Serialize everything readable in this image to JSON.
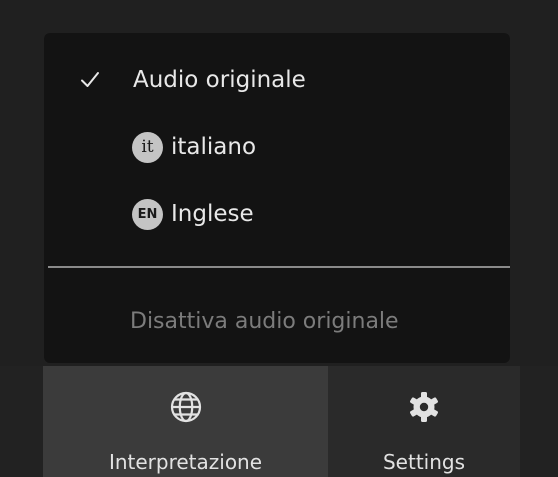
{
  "menu": {
    "items": [
      {
        "label": "Audio originale",
        "selected": true
      },
      {
        "badge": "it",
        "label": "italiano"
      },
      {
        "badge": "EN",
        "label": "Inglese"
      }
    ],
    "disable_label": "Disattiva audio originale"
  },
  "toolbar": {
    "interpretation": {
      "label": "Interpretazione",
      "icon": "globe-icon"
    },
    "settings": {
      "label": "Settings",
      "icon": "gear-icon"
    }
  },
  "colors": {
    "menu_bg": "#131313",
    "toolbar_active_bg": "#3b3b3b",
    "badge_bg": "#c4c4c4",
    "disabled_text": "#7c7c7c"
  }
}
